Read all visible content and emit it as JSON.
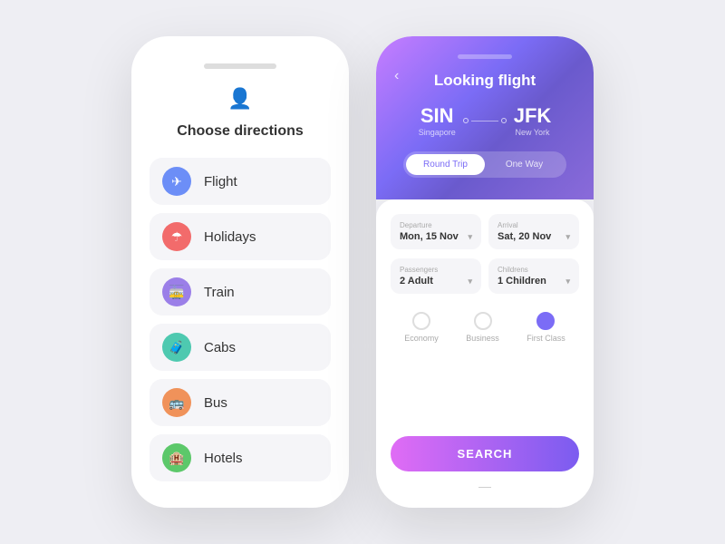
{
  "left_phone": {
    "title": "Choose directions",
    "menu_items": [
      {
        "id": "flight",
        "label": "Flight",
        "icon": "✈",
        "color": "#6c8ef7"
      },
      {
        "id": "holidays",
        "label": "Holidays",
        "icon": "☂",
        "color": "#f26b6b"
      },
      {
        "id": "train",
        "label": "Train",
        "icon": "🚋",
        "color": "#9b7fe8"
      },
      {
        "id": "cabs",
        "label": "Cabs",
        "icon": "🧳",
        "color": "#4ec9b0"
      },
      {
        "id": "bus",
        "label": "Bus",
        "icon": "🚌",
        "color": "#f0925a"
      },
      {
        "id": "hotels",
        "label": "Hotels",
        "icon": "🏨",
        "color": "#5cc86a"
      }
    ]
  },
  "right_phone": {
    "header_title": "Looking flight",
    "back_label": "‹",
    "origin": {
      "code": "SIN",
      "name": "Singapore"
    },
    "destination": {
      "code": "JFK",
      "name": "New York"
    },
    "trip_options": [
      {
        "id": "round",
        "label": "Round Trip",
        "active": true
      },
      {
        "id": "oneway",
        "label": "One Way",
        "active": false
      }
    ],
    "form_fields": {
      "departure_label": "Departure",
      "departure_value": "Mon, 15 Nov",
      "arrival_label": "Arrival",
      "arrival_value": "Sat, 20 Nov",
      "passengers_label": "Passengers",
      "passengers_value": "2 Adult",
      "children_label": "Childrens",
      "children_value": "1 Children"
    },
    "classes": [
      {
        "id": "economy",
        "label": "Economy",
        "selected": false
      },
      {
        "id": "business",
        "label": "Business",
        "selected": false
      },
      {
        "id": "first",
        "label": "First Class",
        "selected": true
      }
    ],
    "search_label": "SEARCH",
    "home_indicator": "—"
  }
}
